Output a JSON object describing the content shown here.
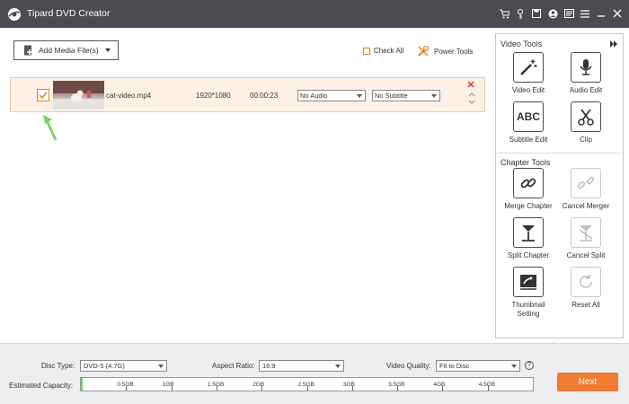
{
  "app": {
    "title": "Tipard DVD Creator"
  },
  "toolbar": {
    "add_media_label": "Add Media File(s)",
    "check_all_label": "Check All",
    "power_tools_label": "Power Tools"
  },
  "media_item": {
    "filename": "cat-video.mp4",
    "resolution": "1920*1080",
    "duration": "00:00:23",
    "audio": "No Audio",
    "subtitle": "No Subtitle",
    "checked": true
  },
  "sidebar": {
    "video_tools_title": "Video Tools",
    "video_tools": [
      {
        "label": "Video Edit",
        "icon": "magic-wand-icon"
      },
      {
        "label": "Audio Edit",
        "icon": "microphone-icon"
      },
      {
        "label": "Subtitle Edit",
        "icon": "abc-icon"
      },
      {
        "label": "Clip",
        "icon": "scissors-icon"
      }
    ],
    "abc_text": "ABC",
    "chapter_tools_title": "Chapter Tools",
    "chapter_tools": [
      {
        "label": "Merge Chapter",
        "icon": "link-icon",
        "enabled": true
      },
      {
        "label": "Cancel Merger",
        "icon": "unlink-icon",
        "enabled": false
      },
      {
        "label": "Split Chapter",
        "icon": "split-icon",
        "enabled": true
      },
      {
        "label": "Cancel Split",
        "icon": "cancel-split-icon",
        "enabled": false
      },
      {
        "label_line1": "Thumbnail",
        "label_line2": "Setting",
        "icon": "thumbnail-icon",
        "enabled": true
      },
      {
        "label": "Reset All",
        "icon": "reset-icon",
        "enabled": false
      }
    ]
  },
  "bottom": {
    "disc_type_label": "Disc Type:",
    "disc_type_value": "DVD-5 (4.7G)",
    "aspect_ratio_label": "Aspect Ratio:",
    "aspect_ratio_value": "16:9",
    "video_quality_label": "Video Quality:",
    "video_quality_value": "Fit to Disc",
    "help_label": "?",
    "estimated_capacity_label": "Estimated Capacity:",
    "capacity_fraction": 0.003,
    "capacity_ticks": [
      "0.5GB",
      "1GB",
      "1.5GB",
      "2GB",
      "2.5GB",
      "3GB",
      "3.5GB",
      "4GB",
      "4.5GB"
    ],
    "next_label": "Next"
  },
  "colors": {
    "accent": "#f07b33",
    "titlebar": "#4a4c50",
    "capacity_fill": "#6fcf6a",
    "arrow": "#7ed36e"
  }
}
